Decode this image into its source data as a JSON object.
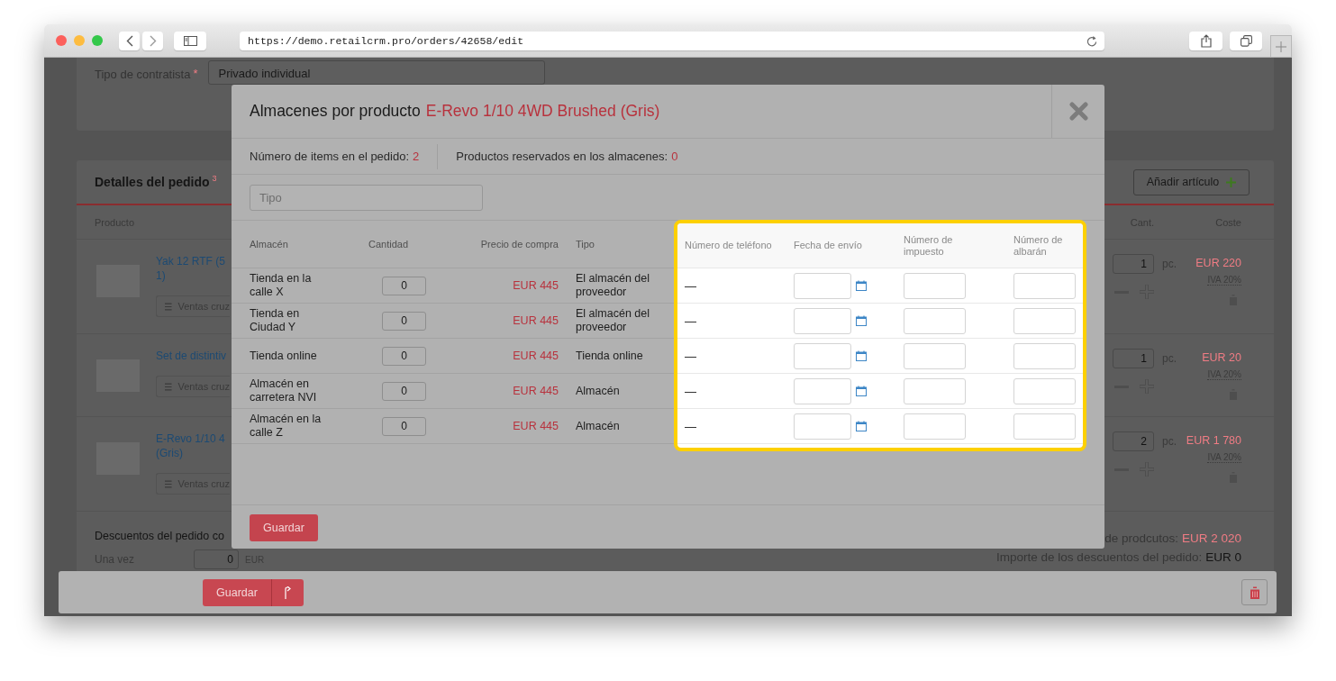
{
  "browser": {
    "url": "https://demo.retailcrm.pro/orders/42658/edit"
  },
  "page": {
    "contractor": {
      "label": "Tipo de contratista",
      "required_mark": "*",
      "value": "Privado individual"
    },
    "order_details": {
      "title": "Detalles del pedido",
      "count": "3",
      "add_button": "Añadir artículo",
      "columns": {
        "product": "Producto",
        "quantity": "Cant.",
        "cost": "Coste"
      },
      "rows": [
        {
          "name_lines": [
            "Yak 12 RTF (5",
            "1)"
          ],
          "cross_sell": "Ventas cruz",
          "quantity": "1",
          "unit": "pc.",
          "price": "EUR 220",
          "tax": "IVA 20%"
        },
        {
          "name_lines": [
            "Set de distintiv"
          ],
          "cross_sell": "Ventas cruz",
          "quantity": "1",
          "unit": "pc.",
          "price": "EUR 20",
          "tax": "IVA 20%"
        },
        {
          "name_lines": [
            "E-Revo 1/10 4",
            "(Gris)"
          ],
          "cross_sell": "Ventas cruz",
          "quantity": "2",
          "unit": "pc.",
          "price": "EUR 1 780",
          "tax": "IVA 20%"
        }
      ]
    },
    "discounts": {
      "title": "Descuentos del pedido co",
      "once_label": "Una vez",
      "once_value": "0",
      "currency": "EUR"
    },
    "totals": [
      {
        "label": "de prodcutos:",
        "value": "EUR 2 020",
        "kind": "accent"
      },
      {
        "label": "Importe de los descuentos del pedido:",
        "value": "EUR 0",
        "kind": "plain"
      }
    ]
  },
  "modal": {
    "title": "Almacenes por producto",
    "product": "E-Revo 1/10 4WD Brushed (Gris)",
    "stats": [
      {
        "label": "Número de items en el pedido:",
        "value": "2"
      },
      {
        "label": "Productos reservados en los almacenes:",
        "value": "0"
      }
    ],
    "filter": {
      "placeholder": "Tipo"
    },
    "columns": [
      "Almacén",
      "Cantidad",
      "Precio de compra",
      "Tipo"
    ],
    "highlighted_columns": [
      "Número de teléfono",
      "Fecha de envío",
      "Número de impuesto",
      "Número de albarán"
    ],
    "rows": [
      {
        "warehouse": "Tienda en la calle X",
        "quantity": "0",
        "price": "EUR 445",
        "type": "El almacén del proveedor",
        "phone": "—"
      },
      {
        "warehouse": "Tienda en Ciudad Y",
        "quantity": "0",
        "price": "EUR 445",
        "type": "El almacén del proveedor",
        "phone": "—"
      },
      {
        "warehouse": "Tienda online",
        "quantity": "0",
        "price": "EUR 445",
        "type": "Tienda online",
        "phone": "—"
      },
      {
        "warehouse": "Almacén en carretera NVI",
        "quantity": "0",
        "price": "EUR 445",
        "type": "Almacén",
        "phone": "—"
      },
      {
        "warehouse": "Almacén en la calle Z",
        "quantity": "0",
        "price": "EUR 445",
        "type": "Almacén",
        "phone": "—"
      }
    ],
    "save_button": "Guardar"
  },
  "action_bar": {
    "save_button": "Guardar"
  }
}
